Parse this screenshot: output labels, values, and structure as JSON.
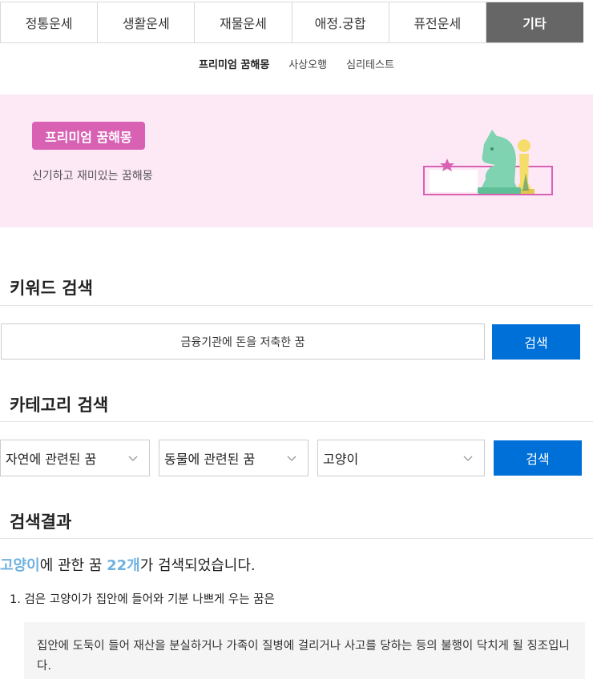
{
  "tabs": [
    {
      "label": "정통운세"
    },
    {
      "label": "생활운세"
    },
    {
      "label": "재물운세"
    },
    {
      "label": "애정.궁합"
    },
    {
      "label": "퓨전운세"
    },
    {
      "label": "기타"
    }
  ],
  "active_tab": "기타",
  "subnav": [
    {
      "label": "프리미엄 꿈해몽"
    },
    {
      "label": "사상오행"
    },
    {
      "label": "심리테스트"
    }
  ],
  "banner": {
    "badge": "프리미엄 꿈해몽",
    "description": "신기하고 재미있는 꿈해몽"
  },
  "keyword_section": {
    "title": "키워드 검색",
    "input_value": "금융기관에 돈을 저축한 꿈",
    "button": "검색"
  },
  "category_section": {
    "title": "카테고리 검색",
    "select1": "자연에 관련된 꿈",
    "select2": "동물에 관련된 꿈",
    "select3": "고양이",
    "button": "검색"
  },
  "results_section": {
    "title": "검색결과",
    "keyword": "고양이",
    "text1": "에 관한 꿈 ",
    "count": "22개",
    "text2": "가 검색되었습니다.",
    "item1": "1. 검은 고양이가 집안에 들어와 기분 나쁘게 우는 꿈은",
    "item1_desc": "집안에 도둑이 들어 재산을 분실하거나 가족이 질병에 걸리거나 사고를 당하는 등의 불행이 닥치게 될 징조입니다."
  },
  "colors": {
    "accent": "#0070d9",
    "active_tab": "#666666",
    "banner_bg": "#fde8f6",
    "badge": "#d861b4",
    "keyword_highlight": "#6fb2e0"
  }
}
